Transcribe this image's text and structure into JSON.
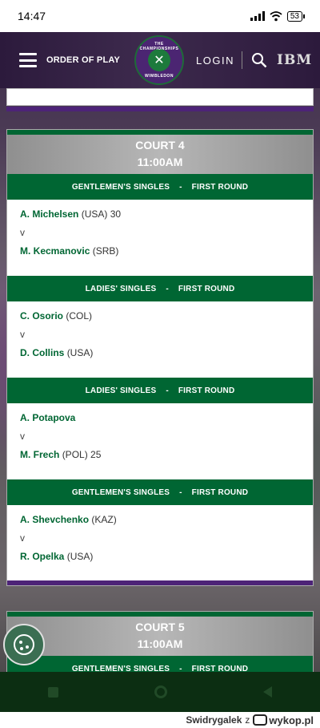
{
  "status_bar": {
    "time": "14:47",
    "battery": "53"
  },
  "header": {
    "menu_label": "ORDER OF PLAY",
    "logo_top_text": "THE CHAMPIONSHIPS",
    "logo_bottom_text": "WIMBLEDON",
    "login_label": "LOGIN",
    "sponsor": "IBM"
  },
  "courts": [
    {
      "name": "COURT 4",
      "time": "11:00AM",
      "matches": [
        {
          "event": "GENTLEMEN'S SINGLES",
          "round": "FIRST ROUND",
          "p1_name": "A. Michelsen",
          "p1_extra": "(USA) 30",
          "vs": "v",
          "p2_name": "M. Kecmanovic",
          "p2_extra": "(SRB)"
        },
        {
          "event": "LADIES' SINGLES",
          "round": "FIRST ROUND",
          "p1_name": "C. Osorio",
          "p1_extra": "(COL)",
          "vs": "v",
          "p2_name": "D. Collins",
          "p2_extra": "(USA)"
        },
        {
          "event": "LADIES' SINGLES",
          "round": "FIRST ROUND",
          "p1_name": "A. Potapova",
          "p1_extra": "",
          "vs": "v",
          "p2_name": "M. Frech",
          "p2_extra": "(POL) 25"
        },
        {
          "event": "GENTLEMEN'S SINGLES",
          "round": "FIRST ROUND",
          "p1_name": "A. Shevchenko",
          "p1_extra": "(KAZ)",
          "vs": "v",
          "p2_name": "R. Opelka",
          "p2_extra": "(USA)"
        }
      ]
    },
    {
      "name": "COURT 5",
      "time": "11:00AM",
      "matches": [
        {
          "event": "GENTLEMEN'S SINGLES",
          "round": "FIRST ROUND"
        }
      ]
    }
  ],
  "separator": "-",
  "footer": {
    "username": "Swidrygalek",
    "via": "z",
    "site": "wykop.pl"
  },
  "colors": {
    "green": "#006633",
    "purple": "#4d2377"
  }
}
